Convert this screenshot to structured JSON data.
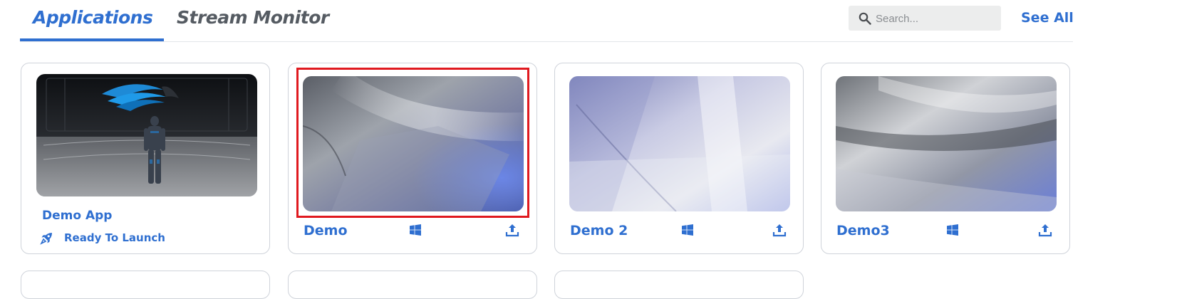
{
  "tabs": [
    {
      "label": "Applications",
      "active": true
    },
    {
      "label": "Stream Monitor",
      "active": false
    }
  ],
  "search": {
    "placeholder": "Search..."
  },
  "see_all": "See All",
  "apps": [
    {
      "name": "Demo App",
      "status": "Ready To Launch"
    },
    {
      "name": "Demo",
      "platform": "windows-icon",
      "action": "upload-icon",
      "selected": true
    },
    {
      "name": "Demo 2",
      "platform": "windows-icon",
      "action": "upload-icon"
    },
    {
      "name": "Demo3",
      "platform": "windows-icon",
      "action": "upload-icon"
    }
  ],
  "colors": {
    "accent": "#2f6fd0",
    "highlight": "#e0191f",
    "tab_inactive": "#555b62"
  }
}
